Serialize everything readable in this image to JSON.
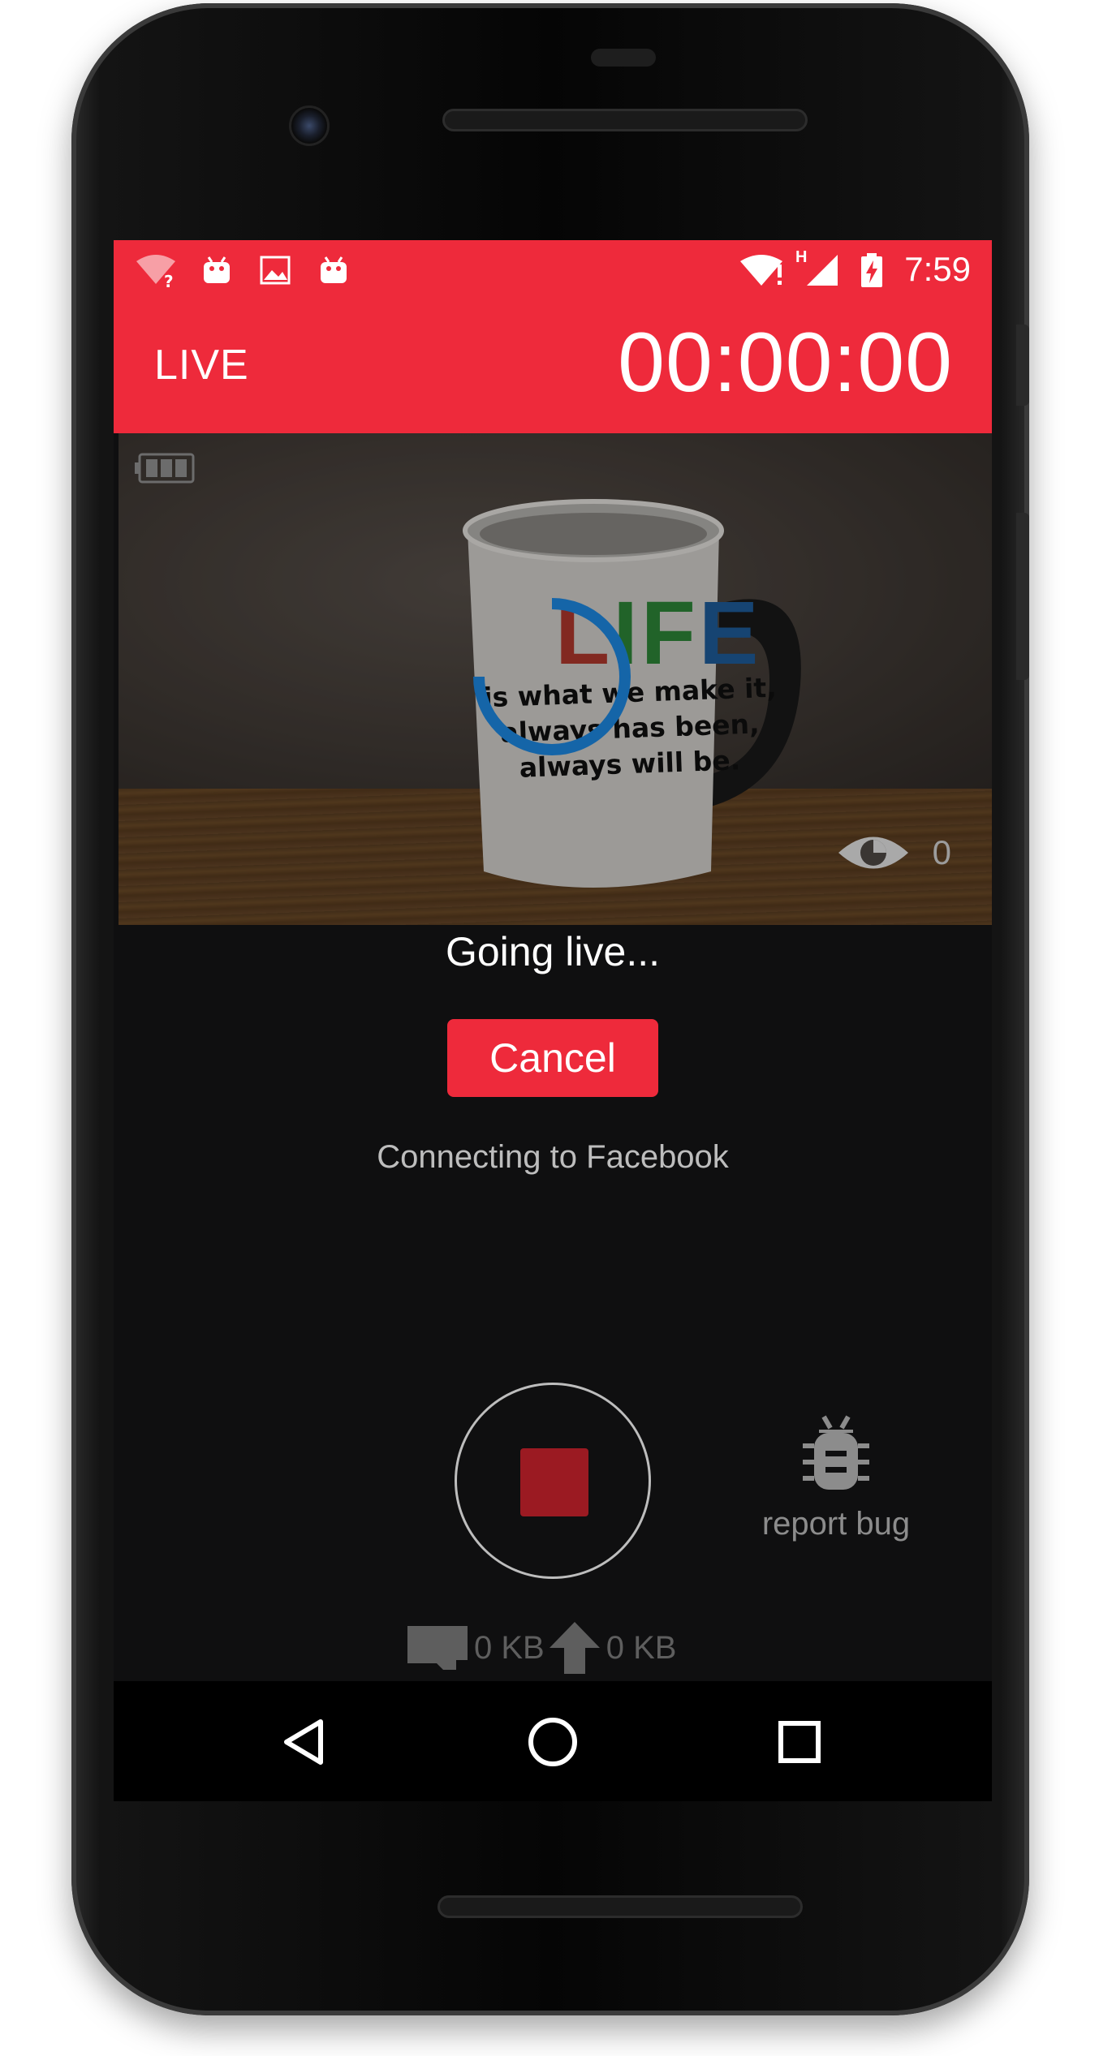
{
  "status_bar": {
    "time": "7:59",
    "network_type": "H",
    "left_icons": [
      "wifi-unknown-icon",
      "android-icon",
      "image-icon",
      "android-icon"
    ],
    "right_icons": [
      "wifi-alert-icon",
      "cell-signal-icon",
      "battery-charging-icon"
    ]
  },
  "app_bar": {
    "title": "LIVE",
    "timer": "00:00:00"
  },
  "preview": {
    "mug_title_letters": [
      "L",
      "I",
      "F",
      "E"
    ],
    "mug_text_lines": [
      "is what we make it,",
      "always has been,",
      "always will be."
    ],
    "viewer_count": "0"
  },
  "status": {
    "heading": "Going live...",
    "cancel_label": "Cancel",
    "message": "Connecting to Facebook"
  },
  "controls": {
    "report_bug_label": "report bug",
    "local_data": "0 KB",
    "uploaded_data": "0 KB"
  },
  "colors": {
    "accent": "#ee2a3b",
    "stop": "#9b1a22",
    "spinner": "#1565a8",
    "background": "#0f0f10"
  }
}
